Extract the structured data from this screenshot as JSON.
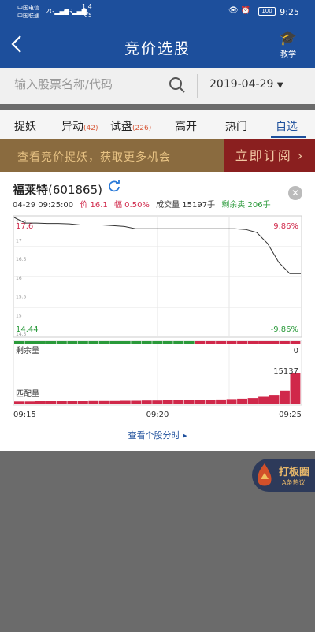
{
  "status_bar": {
    "carrier_1": "中国电信",
    "carrier_2": "中国联通",
    "signal_1": "2G",
    "signal_2": "4G",
    "net_speed": "1.4",
    "net_unit": "K/s",
    "battery": "100",
    "time": "9:25"
  },
  "nav": {
    "title": "竞价选股",
    "teach_label": "教学",
    "back_icon": "chevron-left-icon",
    "teach_icon": "graduation-cap-icon"
  },
  "search": {
    "placeholder": "输入股票名称/代码",
    "date": "2019-04-29"
  },
  "tabs": [
    {
      "label": "捉妖",
      "badge": ""
    },
    {
      "label": "异动",
      "badge": "(42)"
    },
    {
      "label": "试盘",
      "badge": "(226)"
    },
    {
      "label": "高开",
      "badge": ""
    },
    {
      "label": "热门",
      "badge": ""
    },
    {
      "label": "自选",
      "badge": ""
    }
  ],
  "banner": {
    "text": "查看竞价捉妖，获取更多机会",
    "cta": "立即订阅"
  },
  "stock": {
    "name": "福莱特",
    "code": "(601865)",
    "datetime": "04-29 09:25:00",
    "price_label": "价 16.1",
    "change_label": "幅 0.50%",
    "volume_label": "成交量 15197手",
    "remain_label": "剩余卖 206手"
  },
  "chart_labels": {
    "price_top": "17.6",
    "price_bottom": "14.44",
    "pct_top": "9.86%",
    "pct_bottom": "-9.86%",
    "y_ticks": [
      "17.5",
      "17",
      "16.5",
      "16",
      "15.5",
      "15",
      "14.5"
    ],
    "remain_label": "剩余量",
    "remain_value": "0",
    "match_label": "匹配量",
    "match_value": "15137",
    "x_ticks": [
      "09:15",
      "09:20",
      "09:25"
    ]
  },
  "link": {
    "label": "查看个股分时"
  },
  "float_button": {
    "title": "打板圈",
    "subtitle": "A条热议"
  },
  "colors": {
    "nav_blue": "#1d4f9c",
    "up_red": "#d0284a",
    "down_green": "#2a9a3a",
    "banner_brown": "#8a6b3f",
    "cta_red": "#8a1f1f"
  },
  "chart_data": {
    "type": "line",
    "x_range": [
      "09:15",
      "09:25"
    ],
    "ylim": [
      14.44,
      17.6
    ],
    "series": [
      {
        "values": [
          17.6,
          17.45,
          17.45,
          17.44,
          17.44,
          17.43,
          17.4,
          17.4,
          17.4,
          17.38,
          17.36,
          17.3,
          17.3,
          17.3,
          17.3,
          17.3,
          17.3,
          17.3,
          17.3,
          17.3,
          17.3,
          17.28,
          17.2,
          16.9,
          16.4,
          16.1,
          16.1
        ]
      }
    ],
    "remain_bars": [
      0,
      0,
      0,
      0,
      0,
      0,
      0,
      0,
      0,
      0,
      0,
      0,
      0,
      0,
      0,
      0,
      0,
      0,
      0,
      0,
      0,
      0,
      0,
      0,
      0,
      0,
      0
    ],
    "match_bars": [
      1400,
      1400,
      1500,
      1500,
      1500,
      1500,
      1500,
      1600,
      1600,
      1600,
      1700,
      1700,
      1800,
      1800,
      1900,
      2000,
      2000,
      2100,
      2200,
      2300,
      2500,
      2700,
      3000,
      3600,
      4500,
      6500,
      15137
    ]
  }
}
